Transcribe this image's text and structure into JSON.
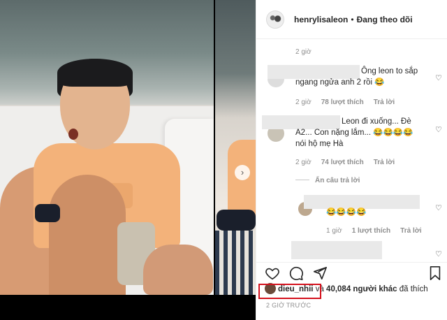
{
  "header": {
    "username": "henrylisaleon",
    "separator": "•",
    "follow_status": "Đang theo dõi"
  },
  "comments": {
    "top_time": "2 giờ",
    "items": [
      {
        "text_line1": "Ông leon to sắp",
        "text_line2": "ngang ngửa anh 2 rồi 😂",
        "time": "2 giờ",
        "likes": "78 lượt thích",
        "reply": "Trả lời"
      },
      {
        "text_line1": "Leon đi xuống... Đè",
        "text_line2": "A2... Con nặng lắm... 😂😂😂😂",
        "text_line3": "nói hộ mẹ Hà",
        "time": "2 giờ",
        "likes": "74 lượt thích",
        "reply": "Trả lời",
        "hide_replies": "Ẩn câu trả lời"
      },
      {
        "text_line1": "😂😂😂😂",
        "time": "1 giờ",
        "likes": "1 lượt thích",
        "reply": "Trả lời"
      }
    ]
  },
  "actions": {
    "like_icon": "heart-icon",
    "comment_icon": "comment-icon",
    "share_icon": "paper-plane-icon",
    "save_icon": "bookmark-icon"
  },
  "likes": {
    "liker": "dieu_nhii",
    "connector": "và",
    "others": "40,084 người khác",
    "suffix": "đã thích"
  },
  "posted": "2 GIỜ TRƯỚC",
  "media": {
    "next_symbol": "›"
  },
  "colors": {
    "highlight": "#d4101c",
    "muted": "#8e8e8e"
  }
}
